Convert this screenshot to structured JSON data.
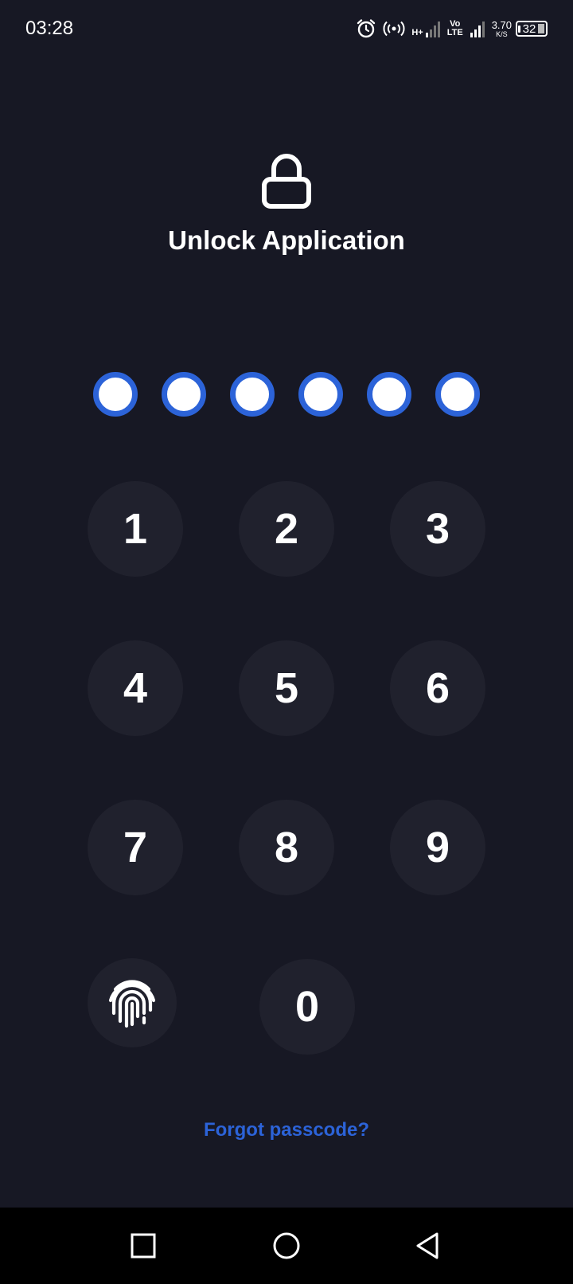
{
  "status_bar": {
    "time": "03:28",
    "network_type": "H+",
    "volte_top": "Vo",
    "volte_bottom": "LTE",
    "speed_value": "3.70",
    "speed_unit": "K/S",
    "battery_level": "32"
  },
  "header": {
    "title": "Unlock Application",
    "icon": "lock-icon"
  },
  "pin": {
    "length": 6,
    "filled": 0
  },
  "keypad": {
    "keys": [
      "1",
      "2",
      "3",
      "4",
      "5",
      "6",
      "7",
      "8",
      "9",
      "0"
    ],
    "biometric_icon": "fingerprint-icon"
  },
  "links": {
    "forgot_passcode": "Forgot passcode?"
  },
  "nav_bar": {
    "icons": [
      "recents-icon",
      "home-icon",
      "back-icon"
    ]
  },
  "colors": {
    "background": "#171824",
    "key_background": "#20212d",
    "accent": "#2c63d8",
    "text": "#ffffff"
  }
}
